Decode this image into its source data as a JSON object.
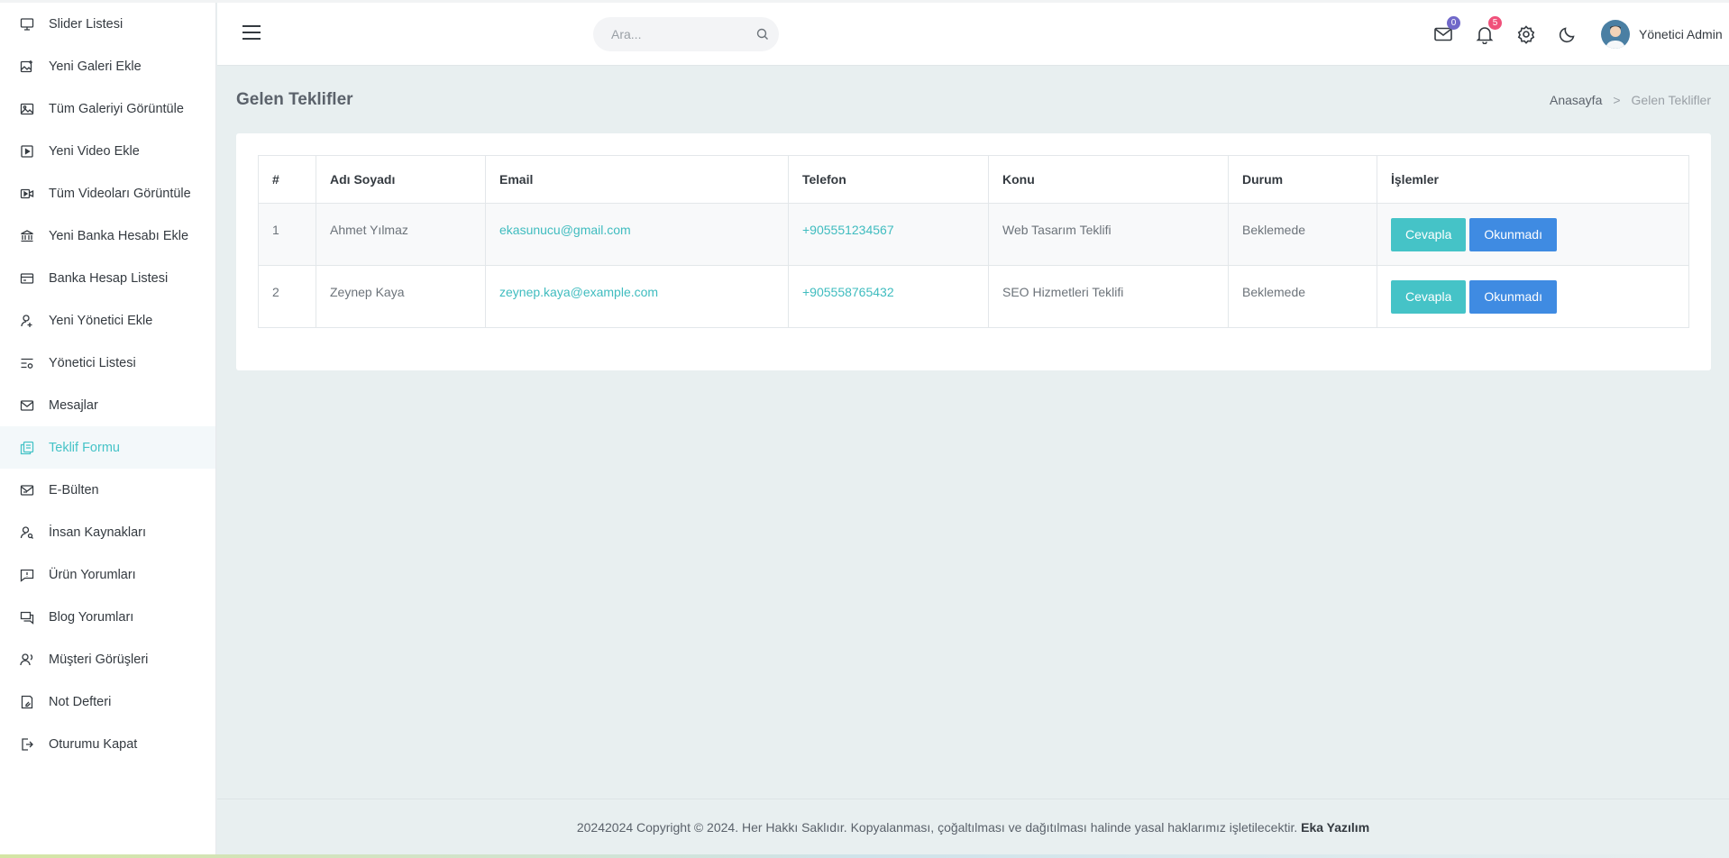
{
  "sidebar": {
    "items": [
      {
        "label": "Slider Listesi",
        "icon": "monitor-icon"
      },
      {
        "label": "Yeni Galeri Ekle",
        "icon": "gallery-add-icon"
      },
      {
        "label": "Tüm Galeriyi Görüntüle",
        "icon": "image-icon"
      },
      {
        "label": "Yeni Video Ekle",
        "icon": "video-play-icon"
      },
      {
        "label": "Tüm Videoları Görüntüle",
        "icon": "video-camera-icon"
      },
      {
        "label": "Yeni Banka Hesabı Ekle",
        "icon": "bank-icon"
      },
      {
        "label": "Banka Hesap Listesi",
        "icon": "credit-card-icon"
      },
      {
        "label": "Yeni Yönetici Ekle",
        "icon": "user-add-icon"
      },
      {
        "label": "Yönetici Listesi",
        "icon": "list-settings-icon"
      },
      {
        "label": "Mesajlar",
        "icon": "mail-icon"
      },
      {
        "label": "Teklif Formu",
        "icon": "files-icon"
      },
      {
        "label": "E-Bülten",
        "icon": "mail-open-icon"
      },
      {
        "label": "İnsan Kaynakları",
        "icon": "user-search-icon"
      },
      {
        "label": "Ürün Yorumları",
        "icon": "message-alert-icon"
      },
      {
        "label": "Blog Yorumları",
        "icon": "chat-icon"
      },
      {
        "label": "Müşteri Görüşleri",
        "icon": "users-voice-icon"
      },
      {
        "label": "Not Defteri",
        "icon": "notebook-icon"
      },
      {
        "label": "Oturumu Kapat",
        "icon": "logout-icon"
      }
    ],
    "active_index": 10
  },
  "header": {
    "search_placeholder": "Ara...",
    "mail_count": "0",
    "notification_count": "5",
    "user_name": "Yönetici Admin"
  },
  "page": {
    "title": "Gelen Teklifler",
    "breadcrumb": [
      "Anasayfa",
      "Gelen Teklifler"
    ]
  },
  "table": {
    "columns": [
      "#",
      "Adı Soyadı",
      "Email",
      "Telefon",
      "Konu",
      "Durum",
      "İşlemler"
    ],
    "rows": [
      {
        "no": "1",
        "name": "Ahmet Yılmaz",
        "email": "ekasunucu@gmail.com",
        "phone": "+905551234567",
        "subject": "Web Tasarım Teklifi",
        "status": "Beklemede"
      },
      {
        "no": "2",
        "name": "Zeynep Kaya",
        "email": "zeynep.kaya@example.com",
        "phone": "+905558765432",
        "subject": "SEO Hizmetleri Teklifi",
        "status": "Beklemede"
      }
    ],
    "actions": {
      "reply": "Cevapla",
      "unread": "Okunmadı"
    }
  },
  "footer": {
    "text": "20242024 Copyright © 2024. Her Hakkı Saklıdır. Kopyalanması, çoğaltılması ve dağıtılması halinde yasal haklarımız işletilecektir.",
    "brand": "Eka Yazılım"
  },
  "colors": {
    "accent": "#45c3c7",
    "primary_button": "#3f8be2",
    "mail_badge": "#7068c9",
    "notification_badge": "#f0507a"
  }
}
